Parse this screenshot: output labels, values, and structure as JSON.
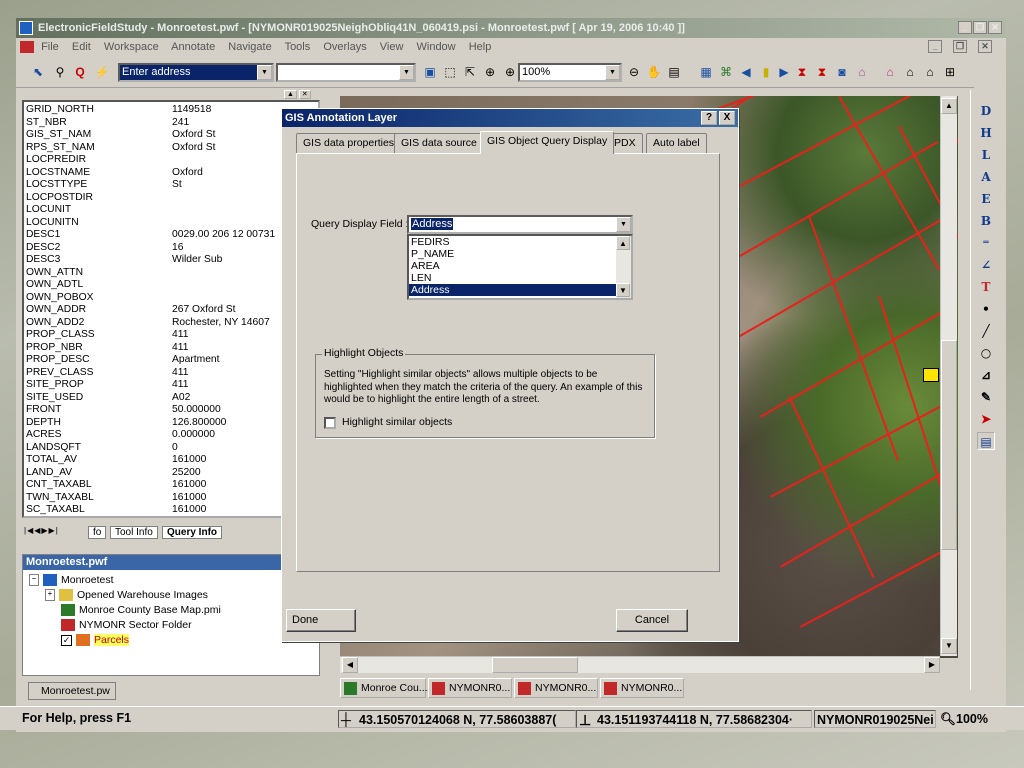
{
  "app": {
    "title": "ElectronicFieldStudy - Monroetest.pwf - [NYMONR019025NeighObliq41N_060419.psi - Monroetest.pwf [ Apr 19, 2006 10:40 ]]",
    "menu": [
      "File",
      "Edit",
      "Workspace",
      "Annotate",
      "Navigate",
      "Tools",
      "Overlays",
      "View",
      "Window",
      "Help"
    ]
  },
  "toolbar": {
    "address_placeholder": "Enter address",
    "zoom": "100%"
  },
  "attributes": [
    {
      "k": "GRID_NORTH",
      "v": "1149518"
    },
    {
      "k": "ST_NBR",
      "v": "241"
    },
    {
      "k": "GIS_ST_NAM",
      "v": "Oxford St"
    },
    {
      "k": "RPS_ST_NAM",
      "v": "Oxford St"
    },
    {
      "k": "LOCPREDIR",
      "v": ""
    },
    {
      "k": "LOCSTNAME",
      "v": "Oxford"
    },
    {
      "k": "LOCSTTYPE",
      "v": "St"
    },
    {
      "k": "LOCPOSTDIR",
      "v": ""
    },
    {
      "k": "LOCUNIT",
      "v": ""
    },
    {
      "k": "LOCUNITN",
      "v": ""
    },
    {
      "k": "DESC1",
      "v": "0029.00 206 12 00731"
    },
    {
      "k": "DESC2",
      "v": "16"
    },
    {
      "k": "DESC3",
      "v": "Wilder Sub"
    },
    {
      "k": "OWN_ATTN",
      "v": ""
    },
    {
      "k": "OWN_ADTL",
      "v": ""
    },
    {
      "k": "OWN_POBOX",
      "v": ""
    },
    {
      "k": "OWN_ADDR",
      "v": "267 Oxford St"
    },
    {
      "k": "OWN_ADD2",
      "v": "Rochester, NY 14607"
    },
    {
      "k": "PROP_CLASS",
      "v": "411"
    },
    {
      "k": "PROP_NBR",
      "v": "411"
    },
    {
      "k": "PROP_DESC",
      "v": "Apartment"
    },
    {
      "k": "PREV_CLASS",
      "v": "411"
    },
    {
      "k": "SITE_PROP",
      "v": "411"
    },
    {
      "k": "SITE_USED",
      "v": "A02"
    },
    {
      "k": "FRONT",
      "v": "50.000000"
    },
    {
      "k": "DEPTH",
      "v": "126.800000"
    },
    {
      "k": "ACRES",
      "v": "0.000000"
    },
    {
      "k": "LANDSQFT",
      "v": "0"
    },
    {
      "k": "TOTAL_AV",
      "v": "161000"
    },
    {
      "k": "LAND_AV",
      "v": "25200"
    },
    {
      "k": "CNT_TAXABL",
      "v": "161000"
    },
    {
      "k": "TWN_TAXABL",
      "v": "161000"
    },
    {
      "k": "SC_TAXABL",
      "v": "161000"
    }
  ],
  "left_tabs": {
    "tab1": "fo",
    "tab2": "Tool Info",
    "tab3": "Query Info"
  },
  "tree": {
    "title": "Monroetest.pwf",
    "root": "Monroetest",
    "items": [
      "Opened Warehouse Images",
      "Monroe County Base Map.pmi",
      "NYMONR Sector Folder",
      "Parcels"
    ],
    "bottom_tab": "Monroetest.pw"
  },
  "dialog": {
    "title": "GIS Annotation Layer",
    "help": "?",
    "close": "X",
    "tabs": [
      "GIS data properties",
      "GIS data source",
      "GIS Object Query Display",
      "PDX",
      "Auto label"
    ],
    "query_label": "Query Display Field :",
    "query_value": "Address",
    "list_items": [
      "FEDIRS",
      "P_NAME",
      "AREA",
      "LEN",
      "Address"
    ],
    "group_title": "Highlight Objects",
    "group_text": "Setting \"Highlight similar objects\" allows multiple objects to be highlighted when they match the criteria of the query.  An example of this would be to highlight the entire length of a street.",
    "checkbox_label": "Highlight similar objects",
    "done": "Done",
    "cancel": "Cancel"
  },
  "task_tabs": [
    "Monroe Cou...",
    "NYMONR0...",
    "NYMONR0...",
    "NYMONR0..."
  ],
  "status": {
    "help": "For Help, press F1",
    "coord1": "43.150570124068 N, 77.58603887(",
    "coord2": "43.151193744118 N, 77.58682304·",
    "image": "NYMONR019025Nei",
    "zoom": "100%"
  }
}
